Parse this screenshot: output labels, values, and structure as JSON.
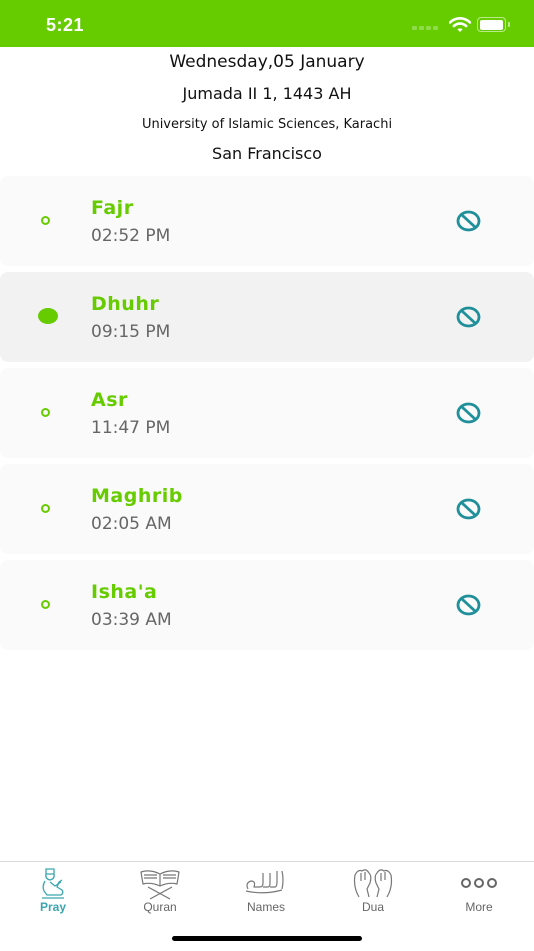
{
  "status_bar": {
    "time": "5:21"
  },
  "header": {
    "gregorian_date": "Wednesday,05 January",
    "hijri_date": "Jumada II 1, 1443 AH",
    "calculation_method": "University of Islamic Sciences, Karachi",
    "city": "San Francisco"
  },
  "prayers": [
    {
      "name": "Fajr",
      "time": "02:52 PM",
      "current": false,
      "alert_icon": "notification-off-icon"
    },
    {
      "name": "Dhuhr",
      "time": "09:15 PM",
      "current": true,
      "alert_icon": "notification-off-icon"
    },
    {
      "name": "Asr",
      "time": "11:47 PM",
      "current": false,
      "alert_icon": "notification-off-icon"
    },
    {
      "name": "Maghrib",
      "time": "02:05 AM",
      "current": false,
      "alert_icon": "notification-off-icon"
    },
    {
      "name": "Isha'a",
      "time": "03:39 AM",
      "current": false,
      "alert_icon": "notification-off-icon"
    }
  ],
  "tabbar": {
    "tabs": [
      {
        "label": "Pray",
        "icon": "praying-man-icon",
        "active": true
      },
      {
        "label": "Quran",
        "icon": "quran-stand-icon",
        "active": false
      },
      {
        "label": "Names",
        "icon": "allah-calligraphy-icon",
        "active": false
      },
      {
        "label": "Dua",
        "icon": "dua-hands-icon",
        "active": false
      },
      {
        "label": "More",
        "icon": "more-dots-icon",
        "active": false
      }
    ]
  },
  "colors": {
    "brand_green": "#66cc00",
    "accent_teal": "#1f8f9a",
    "active_tab": "#3aa6b0"
  }
}
